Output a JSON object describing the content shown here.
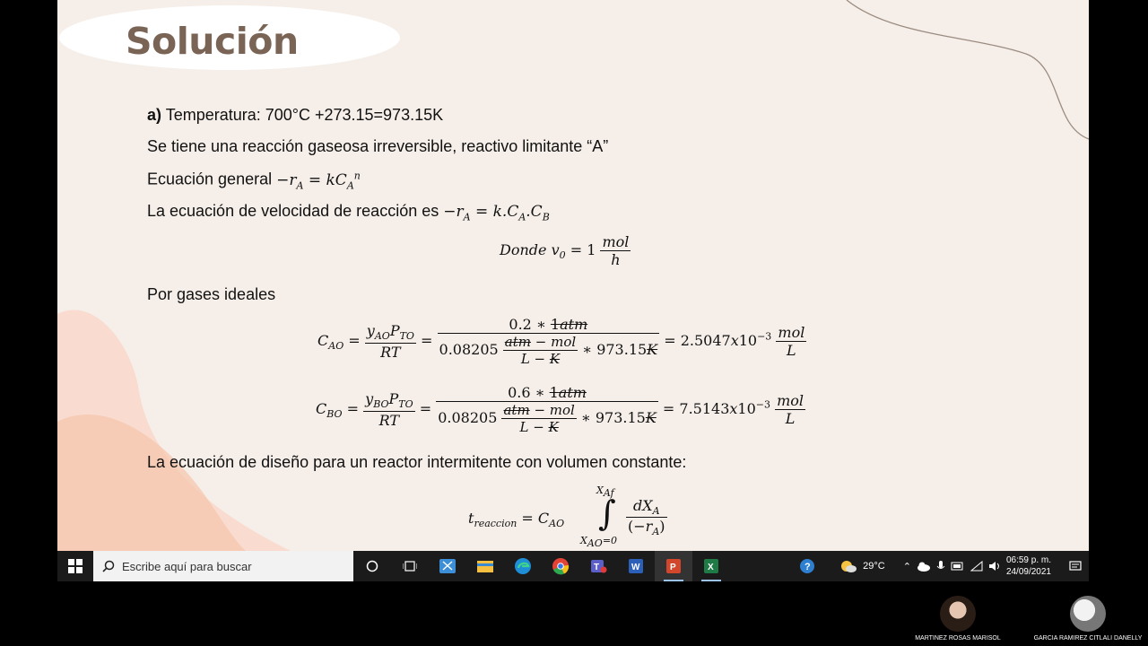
{
  "slide": {
    "title": "Solución",
    "line_a_label": "a)",
    "line_a_text": " Temperatura: 700°C +273.15=973.15K",
    "line_gas": "Se tiene una reacción gaseosa irreversible, reactivo limitante “A”",
    "line_general": "Ecuación general ",
    "line_velocity": "La ecuación de velocidad de reacción es ",
    "line_ideal": "Por gases ideales",
    "line_design": "La ecuación de diseño para un reactor intermitente con  volumen constante:",
    "donde": "Donde",
    "v0_value": "1",
    "cao_num_val": "0.2",
    "cbo_num_val": "0.6",
    "atm_value": "1",
    "r_const": "0.08205",
    "temp_value": "973.15",
    "cao_result": "2.5047",
    "cbo_result": "7.5143",
    "exponent": "−3",
    "upper_limit": "X",
    "lower_limit_value": "0"
  },
  "taskbar": {
    "search_placeholder": "Escribe aquí para buscar",
    "weather": "29°C",
    "time": "06:59 p. m.",
    "date": "24/09/2021",
    "apps": [
      "cortana-icon",
      "task-view-icon",
      "snipping-icon",
      "file-explorer-icon",
      "edge-icon",
      "chrome-icon",
      "teams-icon",
      "word-icon",
      "powerpoint-icon",
      "excel-icon"
    ]
  },
  "participants": [
    {
      "name": "MARTINEZ ROSAS MARISOL"
    },
    {
      "name": "GARCIA RAMIREZ CITLALI DANELLY"
    }
  ],
  "colors": {
    "title": "#7a6455",
    "slide_bg": "#f6efe9",
    "blob": "#f8cdb9",
    "taskbar": "#1b1b1b"
  }
}
